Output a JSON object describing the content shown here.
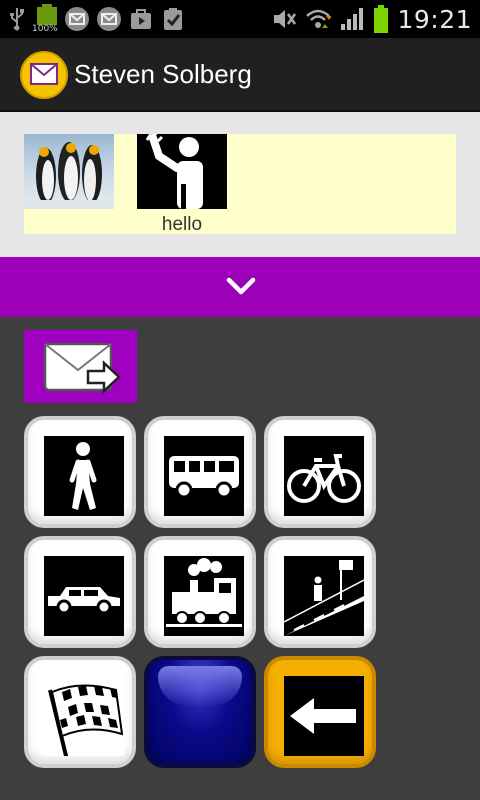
{
  "statusbar": {
    "battery_label": "100%",
    "time": "19:21",
    "icons": [
      "usb-icon",
      "battery-small-icon",
      "mail-icon",
      "mail-icon",
      "shop-icon",
      "clipboard-icon",
      "mute-icon",
      "wifi-icon",
      "signal-icon",
      "battery-icon"
    ]
  },
  "header": {
    "title": "Steven Solberg"
  },
  "message": {
    "items": [
      {
        "type": "penguins-photo",
        "label": ""
      },
      {
        "type": "hello-pictogram",
        "label": "hello"
      }
    ]
  },
  "colors": {
    "accent": "#9c00b8",
    "message_strip": "#ffffcc",
    "back_tile": "#f6ae00",
    "blue_tile": "#0a0a8a"
  },
  "grid": {
    "tiles": [
      {
        "name": "walk-pictogram"
      },
      {
        "name": "bus-pictogram"
      },
      {
        "name": "bicycle-pictogram"
      },
      {
        "name": "car-pictogram"
      },
      {
        "name": "train-pictogram"
      },
      {
        "name": "bus-stop-pictogram"
      },
      {
        "name": "finish-flag-pictogram"
      },
      {
        "name": "blue-button"
      },
      {
        "name": "back-arrow-pictogram"
      }
    ]
  }
}
